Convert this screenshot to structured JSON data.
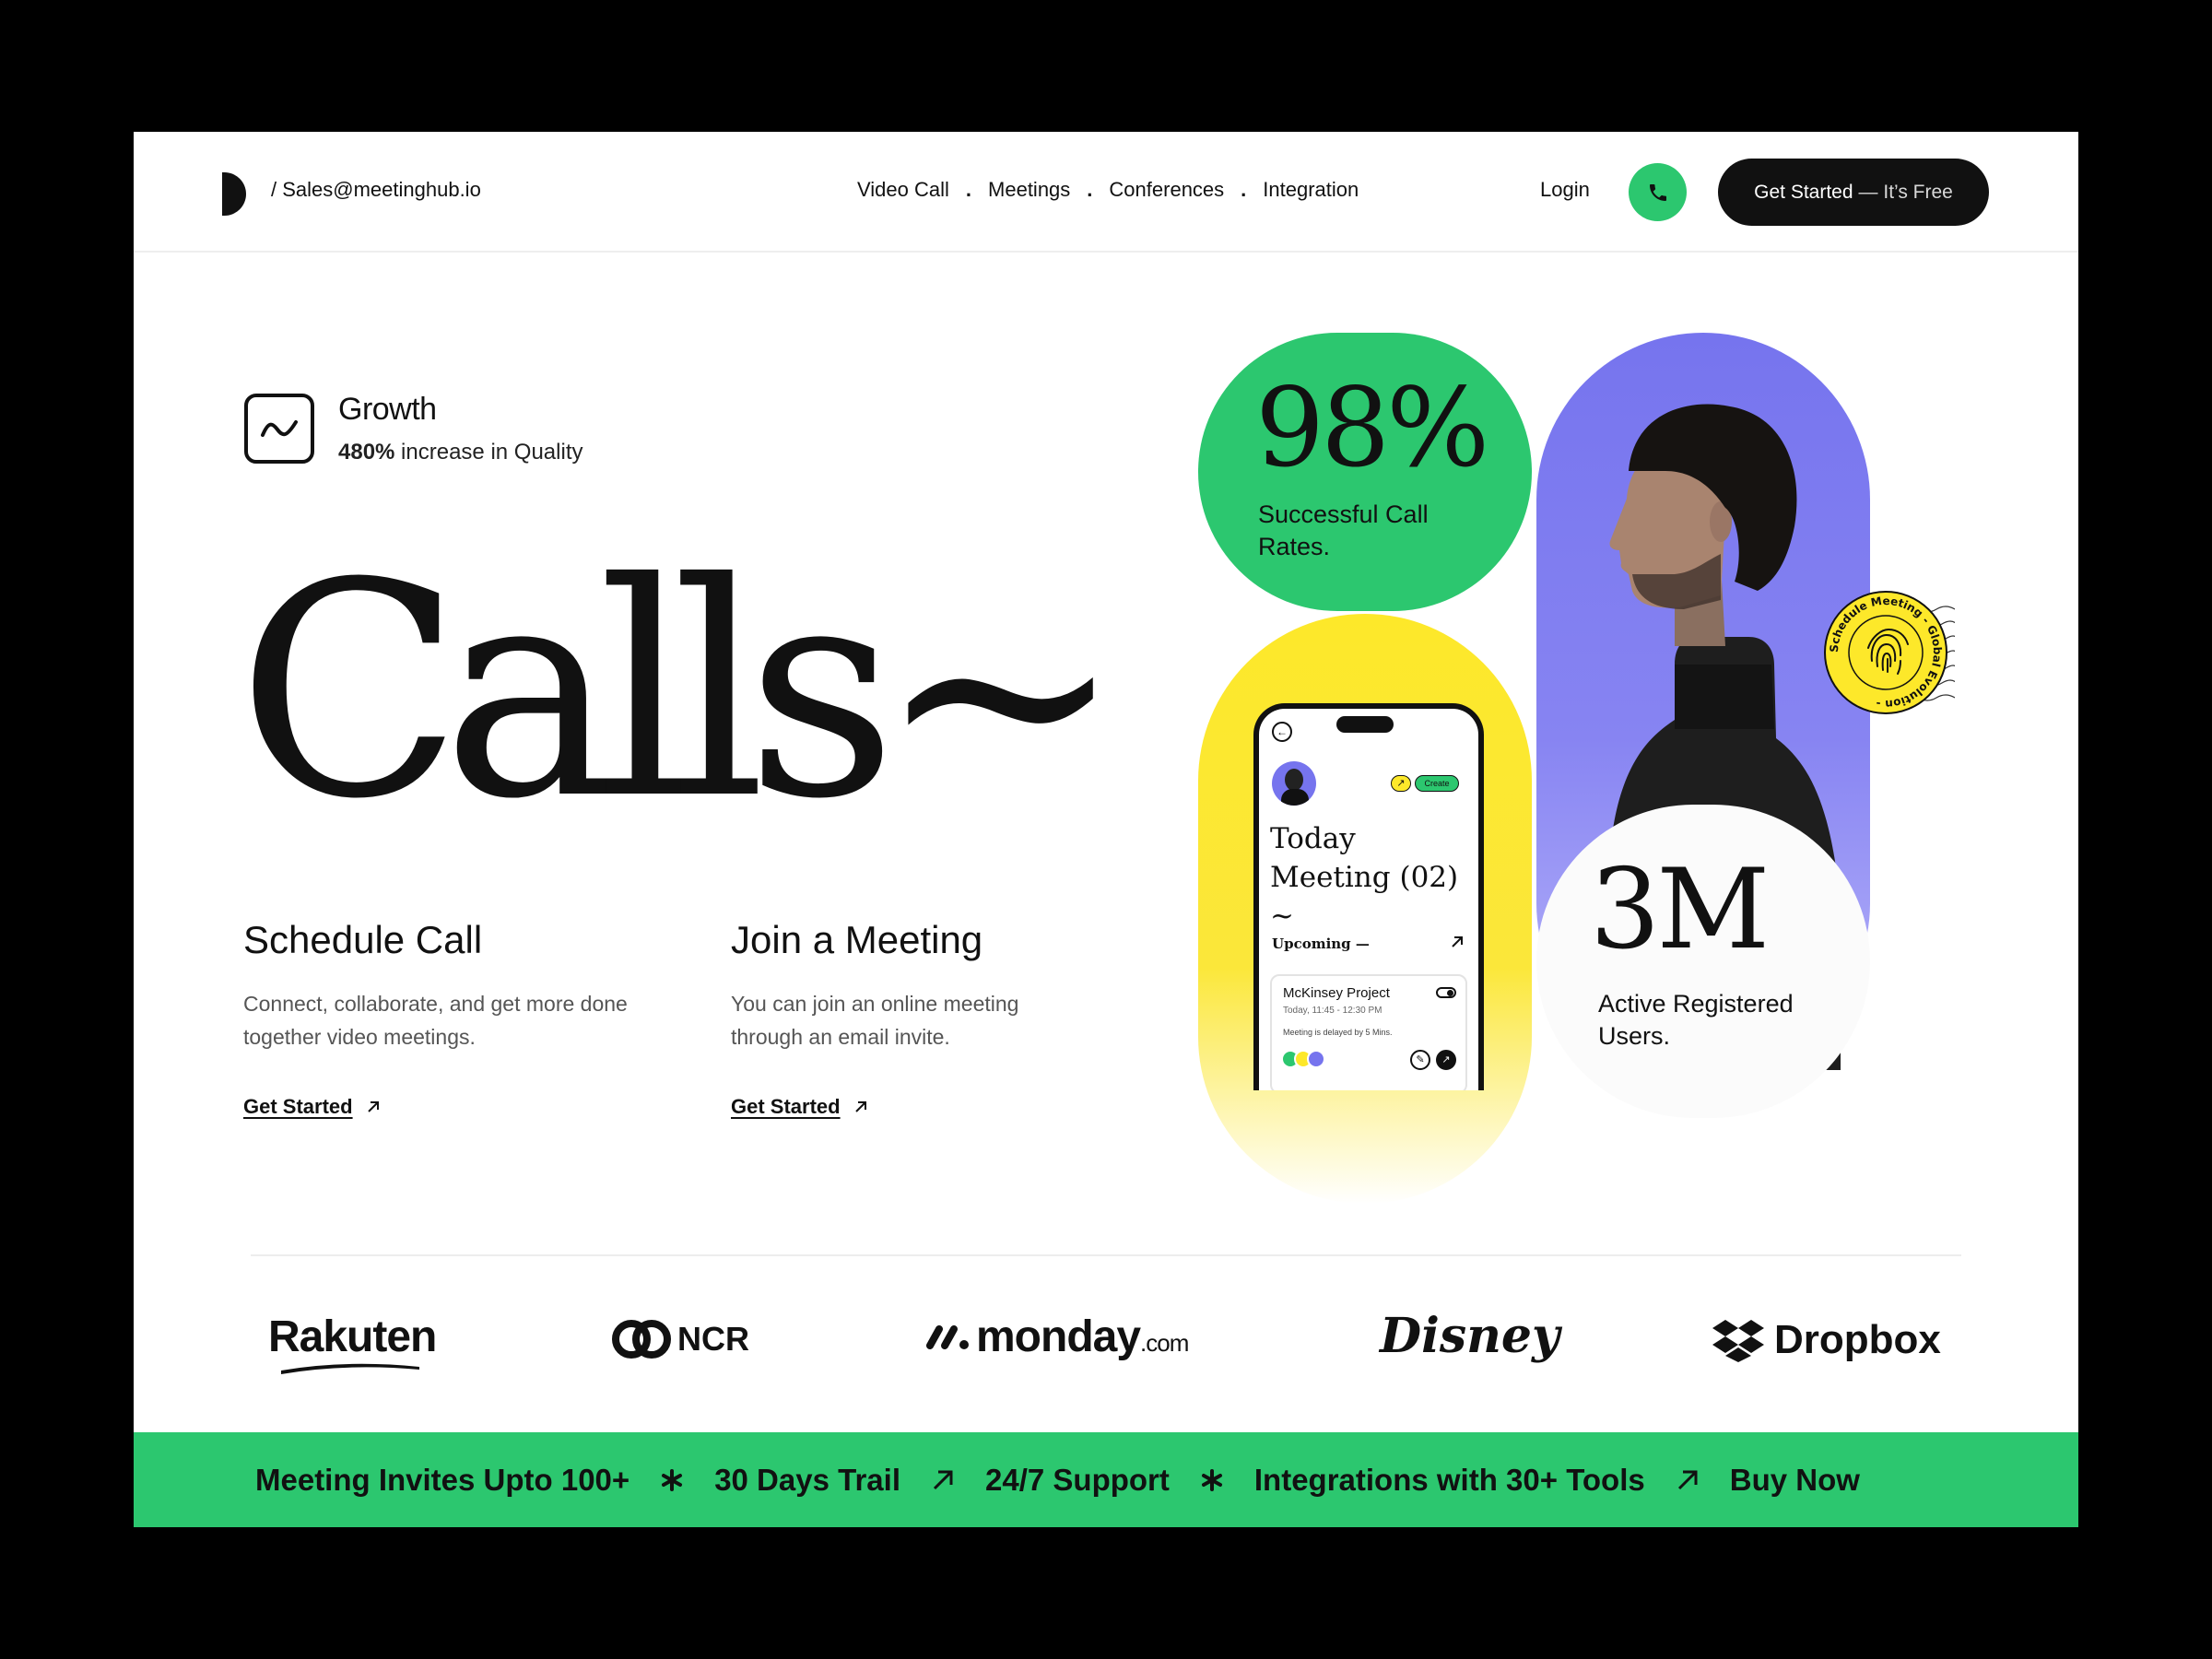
{
  "header": {
    "email": "/ Sales@meetinghub.io",
    "nav": [
      "Video Call",
      "Meetings",
      "Conferences",
      "Integration"
    ],
    "nav_separator": ".",
    "login": "Login",
    "cta_main": "Get Started",
    "cta_suffix": "— It’s Free"
  },
  "growth": {
    "title": "Growth",
    "highlight": "480%",
    "text": " increase in Quality"
  },
  "hero": {
    "title": "Calls~"
  },
  "columns": [
    {
      "title": "Schedule Call",
      "text": "Connect, collaborate, and get more done together video meetings.",
      "link": "Get Started"
    },
    {
      "title": "Join a Meeting",
      "text": "You can join an online meeting through an email invite.",
      "link": "Get Started"
    }
  ],
  "stats": {
    "rate_value": "98%",
    "rate_label": "Successful Call Rates.",
    "users_value": "3M",
    "users_label": "Active Registered Users."
  },
  "phone": {
    "create": "Create",
    "title": "Today Meeting (02) ~",
    "upcoming": "Upcoming —",
    "card_title": "McKinsey Project",
    "card_time": "Today, 11:45 - 12:30 PM",
    "card_note": "Meeting is delayed by 5 Mins."
  },
  "stamp_text": "Schedule Meeting - Global Evolution -",
  "logos": [
    "Rakuten",
    "NCR",
    "monday",
    ".com",
    "Disney",
    "Dropbox"
  ],
  "band": {
    "items": [
      "Meeting Invites Upto 100+",
      "30 Days Trail",
      "24/7 Support",
      "Integrations with 30+ Tools",
      "Buy Now"
    ]
  },
  "colors": {
    "green": "#2cc76f",
    "yellow": "#fde82a",
    "purple": "#7674ee",
    "dark": "#111111"
  },
  "icons": [
    "phone-icon",
    "trend-icon",
    "arrow-up-right-icon",
    "asterisk-icon",
    "fingerprint-icon",
    "dropbox-icon",
    "ncr-icon",
    "monday-icon"
  ]
}
